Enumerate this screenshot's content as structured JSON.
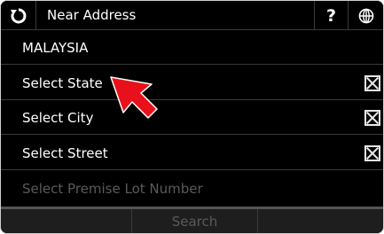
{
  "header": {
    "title": "Near Address",
    "help_label": "?",
    "back_icon": "refresh-back-icon",
    "globe_icon": "globe-icon"
  },
  "rows": {
    "country": "MALAYSIA",
    "state": "Select State",
    "city": "Select City",
    "street": "Select Street",
    "premise": "Select Premise Lot Number"
  },
  "bottom": {
    "search_label": "Search"
  },
  "colors": {
    "background": "#000000",
    "text": "#ffffff",
    "disabled_text": "#5a5a5a",
    "arrow": "#e8111b"
  }
}
